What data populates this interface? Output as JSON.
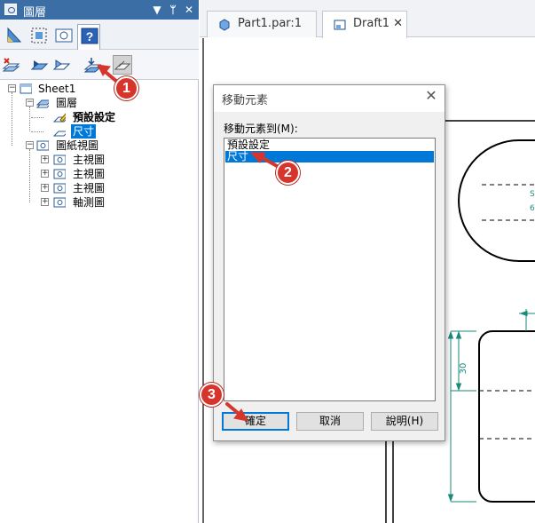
{
  "panel": {
    "title": "圖層",
    "title_buttons": {
      "menu": "▼",
      "pin": "ᛘ",
      "close": "✕"
    }
  },
  "tree": {
    "sheet": "Sheet1",
    "layers_group": "圖層",
    "layer_default": "預設設定",
    "layer_dimension": "尺寸",
    "views_group": "圖紙視圖",
    "views": [
      "主視圖",
      "主視圖",
      "主視圖",
      "軸測圖"
    ]
  },
  "doc_tabs": [
    {
      "label": "Part1.par:1",
      "icon": "part-icon"
    },
    {
      "label": "Draft1",
      "icon": "draft-icon",
      "close": "✕"
    }
  ],
  "dialog": {
    "title": "移動元素",
    "close": "✕",
    "label": "移動元素到(M):",
    "list_items": [
      "預設設定",
      "尺寸"
    ],
    "selected_index": 1,
    "buttons": {
      "ok": "確定",
      "cancel": "取消",
      "help": "說明(H)"
    }
  },
  "drawing": {
    "dimension_text": "30"
  },
  "callouts": [
    "1",
    "2",
    "3"
  ],
  "colors": {
    "title_bar": "#3a6ea5",
    "selection": "#0078d7",
    "callout": "#d7352b",
    "dimension": "#1a8a7a"
  }
}
